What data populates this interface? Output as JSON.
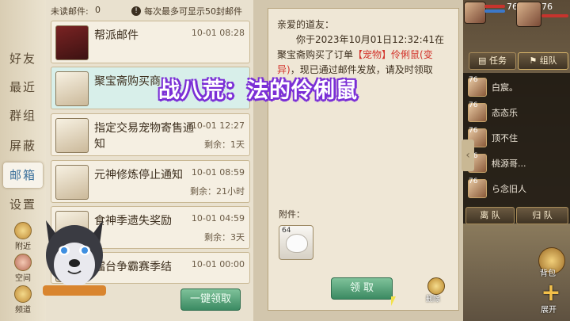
{
  "tabs": {
    "items": [
      {
        "label": "好友"
      },
      {
        "label": "最近"
      },
      {
        "label": "群组"
      },
      {
        "label": "屏蔽"
      },
      {
        "label": "邮箱"
      },
      {
        "label": "设置"
      }
    ],
    "nearby": "附近",
    "space": "空间",
    "channel": "频道"
  },
  "list": {
    "unread_label": "未读邮件:",
    "unread_count": "0",
    "limit_notice": "每次最多可显示50封邮件",
    "mails": [
      {
        "title": "帮派邮件",
        "date": "10-01 08:28",
        "remain": ""
      },
      {
        "title": "聚宝斋购买商",
        "date": "",
        "remain": ""
      },
      {
        "title": "指定交易宠物寄售通知",
        "date": "10-01 12:27",
        "remain": "剩余：1天"
      },
      {
        "title": "元神修炼停止通知",
        "date": "10-01 08:59",
        "remain": "剩余：21小时"
      },
      {
        "title": "食神季遗失奖励",
        "date": "10-01 04:59",
        "remain": "剩余：3天"
      },
      {
        "title": "擂台争霸赛季结",
        "date": "10-01 00:00",
        "remain": ""
      }
    ],
    "collect_all": "一键领取"
  },
  "detail": {
    "greeting": "亲爱的道友：",
    "body_1": "你于2023年10月01日12:32:41在聚宝斋购买了订单",
    "highlight": "【宠物】伶俐鼠(变异)",
    "body_2": "，现已通过邮件发放，请及时领取",
    "attach_label": "附件：",
    "item_count": "64",
    "claim_button": "领 取",
    "delete_label": "删除"
  },
  "caption": "战八荒：法的伶俐鼠",
  "hud": {
    "level_1": "76",
    "level_2": "76",
    "task_btn": "任务",
    "team_btn": "组队",
    "leave_team": "离 队",
    "return_team": "归 队",
    "backpack": "背包",
    "expand": "展开",
    "members": [
      {
        "lv": "76",
        "name": "白宸。"
      },
      {
        "lv": "76",
        "name": "态态乐"
      },
      {
        "lv": "76",
        "name": "顶不住"
      },
      {
        "lv": "76",
        "name": "桃源哥..."
      },
      {
        "lv": "76",
        "name": "ら念旧人"
      }
    ]
  },
  "colors": {
    "accent_red": "#d2332b",
    "tab_active": "#3a6f9a",
    "caption_outline": "#7b2fd6"
  }
}
